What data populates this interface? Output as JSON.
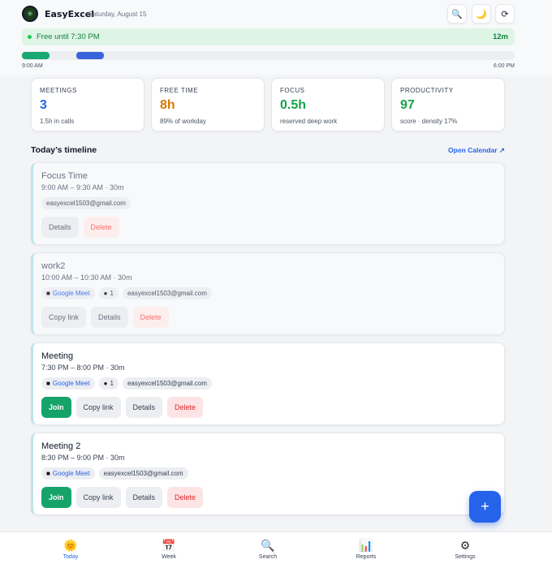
{
  "app": {
    "title": "EasyExcel",
    "date": "Saturday, August 15"
  },
  "header_buttons": [
    {
      "name": "search-icon",
      "glyph": "🔍"
    },
    {
      "name": "moon-icon",
      "glyph": "🌙"
    },
    {
      "name": "refresh-icon",
      "glyph": "⟳"
    }
  ],
  "free_status": {
    "text": "Free until 7:30 PM",
    "remaining": "12m"
  },
  "day_track": {
    "start_label": "9:00 AM",
    "end_label": "6:00 PM",
    "segments": [
      {
        "start_hour": 9.0,
        "end_hour": 9.5,
        "color": "#1aa873"
      },
      {
        "start_hour": 10.0,
        "end_hour": 10.5,
        "color": "#3b63d9"
      }
    ]
  },
  "stats": [
    {
      "label": "MEETINGS",
      "value": "3",
      "sub": "1.5h in calls",
      "color": "#2563eb"
    },
    {
      "label": "FREE TIME",
      "value": "8h",
      "sub": "89% of workday",
      "color": "#d97706"
    },
    {
      "label": "FOCUS",
      "value": "0.5h",
      "sub": "reserved deep work",
      "color": "#16a34a"
    },
    {
      "label": "PRODUCTIVITY",
      "value": "97",
      "sub": "score · density 17%",
      "color": "#16a34a"
    }
  ],
  "timeline": {
    "title": "Today’s timeline",
    "open_calendar": "Open Calendar ↗"
  },
  "events": [
    {
      "title": "Focus Time",
      "time": "9:00 AM – 9:30 AM · 30m",
      "email": "easyexcel1503@gmail.com",
      "details_label": "Details",
      "delete_label": "Delete"
    },
    {
      "title": "work2",
      "time": "10:00 AM – 10:30 AM · 30m",
      "meet_label": "Google Meet",
      "attendees": "1",
      "email": "easyexcel1503@gmail.com",
      "copy_label": "Copy link",
      "details_label": "Details",
      "delete_label": "Delete"
    },
    {
      "title": "Meeting",
      "time": "7:30 PM – 8:00 PM · 30m",
      "meet_label": "Google Meet",
      "attendees": "1",
      "email": "easyexcel1503@gmail.com",
      "join_label": "Join",
      "copy_label": "Copy link",
      "details_label": "Details",
      "delete_label": "Delete"
    },
    {
      "title": "Meeting 2",
      "time": "8:30 PM – 9:00 PM · 30m",
      "meet_label": "Google Meet",
      "email": "easyexcel1503@gmail.com",
      "join_label": "Join",
      "copy_label": "Copy link",
      "details_label": "Details",
      "delete_label": "Delete"
    }
  ],
  "fab_label": "+",
  "nav": [
    {
      "label": "Today",
      "icon": "sun-icon",
      "glyph": "🌞",
      "active": true
    },
    {
      "label": "Week",
      "icon": "calendar-icon",
      "glyph": "📅",
      "active": false
    },
    {
      "label": "Search",
      "icon": "search-icon",
      "glyph": "🔍",
      "active": false
    },
    {
      "label": "Reports",
      "icon": "chart-icon",
      "glyph": "📊",
      "active": false
    },
    {
      "label": "Settings",
      "icon": "gear-icon",
      "glyph": "⚙",
      "active": false
    }
  ]
}
